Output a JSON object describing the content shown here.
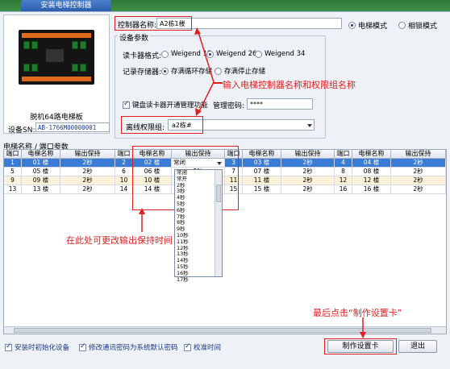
{
  "window": {
    "title": "安装电梯控制器"
  },
  "device": {
    "name": "脱机64路电梯板",
    "sn_label": "设备SN:",
    "sn_value": "AB-1766M00000001"
  },
  "controller": {
    "name_label": "控制器名称:",
    "name_value": "A2栋1楼"
  },
  "mode": {
    "options": [
      "电梯模式",
      "相锁模式"
    ],
    "selected": 0
  },
  "params": {
    "title": "设备参数",
    "reader_label": "读卡器格式:",
    "reader_options": [
      "Weigend 18",
      "Weigend 26",
      "Weigend 34"
    ],
    "reader_selected": 1,
    "storage_label": "记录存储器:",
    "storage_options": [
      "存满循环存储",
      "存满停止存储"
    ],
    "storage_selected": 0,
    "keypad_label": "键盘读卡器开通管理功能",
    "keypad_checked": true,
    "password_label": "管理密码:",
    "password_value": "****",
    "offline_label": "离线权限组:",
    "offline_value": "a2栋#"
  },
  "annotations": {
    "input_hint": "输入电梯控制器名称和权限组名称",
    "hold_hint": "在此处可更改输出保持时间",
    "final_hint": "最后点击“制作设置卡”"
  },
  "grid": {
    "section_label": "电梯名称 / 端口参数",
    "headers": [
      "端口",
      "电梯名称",
      "输出保持",
      "端口",
      "电梯名称",
      "输出保持",
      "端口",
      "电梯名称",
      "输出保持",
      "端口",
      "电梯名称",
      "输出保持"
    ],
    "rows": [
      [
        "1",
        "01 楼",
        "2秒",
        "2",
        "02 楼",
        "2秒",
        "3",
        "03 楼",
        "2秒",
        "4",
        "04 楼",
        "2秒"
      ],
      [
        "5",
        "05 楼",
        "2秒",
        "6",
        "06 楼",
        "2秒",
        "7",
        "07 楼",
        "2秒",
        "8",
        "08 楼",
        "2秒"
      ],
      [
        "9",
        "09 楼",
        "2秒",
        "10",
        "10 楼",
        "2秒",
        "11",
        "11 楼",
        "2秒",
        "12",
        "12 楼",
        "2秒"
      ],
      [
        "13",
        "13 楼",
        "2秒",
        "14",
        "14 楼",
        "2秒",
        "15",
        "15 楼",
        "2秒",
        "16",
        "16 楼",
        "2秒"
      ]
    ],
    "edit_value": "常闭",
    "dropdown_items": [
      "常闭",
      "常开",
      "2秒",
      "3秒",
      "4秒",
      "5秒",
      "6秒",
      "7秒",
      "8秒",
      "9秒",
      "10秒",
      "11秒",
      "12秒",
      "13秒",
      "14秒",
      "15秒",
      "16秒",
      "17秒"
    ]
  },
  "footer": {
    "options": [
      {
        "label": "安装时初始化设备",
        "checked": true
      },
      {
        "label": "修改通讯密码为系统默认密码",
        "checked": true
      },
      {
        "label": "校准时间",
        "checked": true
      }
    ],
    "make_card_button": "制作设置卡",
    "exit_button": "退出"
  },
  "colors": {
    "accent": "#3a7bd5",
    "annotation": "#e02020",
    "row_alt": "#fdf1d9"
  }
}
